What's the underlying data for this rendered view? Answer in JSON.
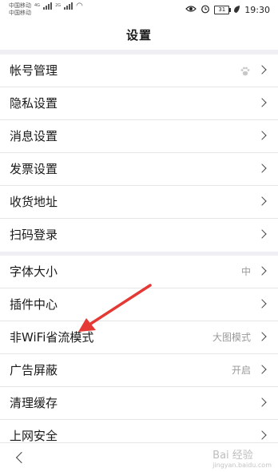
{
  "status_bar": {
    "carrier1": "中国移动",
    "carrier2": "中国移动",
    "net1": "4G",
    "net2": "2G",
    "battery": "31",
    "time": "19:30"
  },
  "header": {
    "title": "设置"
  },
  "group1": [
    {
      "label": "帐号管理",
      "icon": "paw-icon"
    },
    {
      "label": "隐私设置"
    },
    {
      "label": "消息设置"
    },
    {
      "label": "发票设置"
    },
    {
      "label": "收货地址"
    },
    {
      "label": "扫码登录"
    }
  ],
  "group2": [
    {
      "label": "字体大小",
      "value": "中"
    },
    {
      "label": "插件中心"
    },
    {
      "label": "非WiFi省流模式",
      "value": "大图模式"
    },
    {
      "label": "广告屏蔽",
      "value": "开启"
    },
    {
      "label": "清理缓存"
    },
    {
      "label": "上网安全"
    }
  ],
  "watermark": {
    "text": "Bai 经验",
    "sub": "jingyan.baidu.com"
  },
  "colors": {
    "annotation_arrow": "#e53935",
    "background": "#efeff4"
  }
}
